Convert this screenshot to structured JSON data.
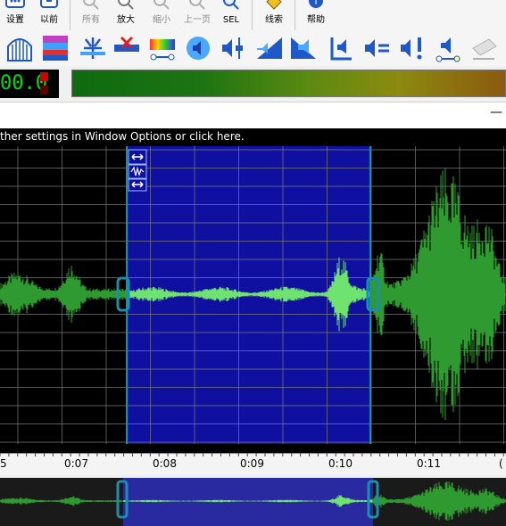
{
  "toolbar_top": {
    "settings_label": "设置",
    "previous_label": "以前",
    "all_label": "所有",
    "zoom_in_label": "放大",
    "zoom_out_label": "缩小",
    "prev_page_label": "上一页",
    "sel_label": "SEL",
    "search_label": "线索",
    "help_label": "帮助"
  },
  "level_display": {
    "time_value": "00.0"
  },
  "info_bar": {
    "text": "ther settings in Window Options or click here."
  },
  "minimize_glyph": "—",
  "time_ruler": {
    "labels": [
      "5",
      "0:07",
      "0:08",
      "0:09",
      "0:10",
      "0:11",
      "("
    ]
  },
  "colors": {
    "waveform_bg": "#000000",
    "selection_bg": "#0f10a0",
    "waveform_green": "#2f9a2f",
    "selected_waveform": "#6fe36f",
    "selection_handle": "#1a8fb0"
  }
}
